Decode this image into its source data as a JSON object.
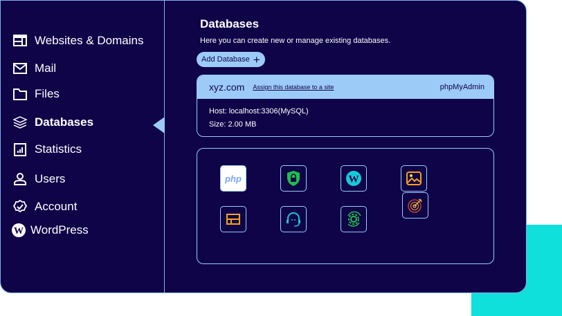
{
  "sidebar": {
    "items": [
      {
        "label": "Websites & Domains",
        "icon": "browser-window-icon"
      },
      {
        "label": "Mail",
        "icon": "envelope-icon"
      },
      {
        "label": "Files",
        "icon": "folder-icon"
      },
      {
        "label": "Databases",
        "icon": "layers-icon",
        "active": true
      },
      {
        "label": "Statistics",
        "icon": "bar-chart-icon"
      },
      {
        "label": "Users",
        "icon": "user-icon"
      },
      {
        "label": "Account",
        "icon": "badge-check-icon"
      },
      {
        "label": "WordPress",
        "icon": "wordpress-icon"
      }
    ]
  },
  "main": {
    "title": "Databases",
    "subtitle": "Here you can create new or manage existing databases.",
    "add_button": "Add Database",
    "database": {
      "name": "xyz.com",
      "assign_link": "Assign this database to a site",
      "admin_link": "phpMyAdmin",
      "host": "Host: localhost:3306(MySQL)",
      "size": "Size: 2.00 MB"
    },
    "apps": {
      "php_label": "php"
    }
  },
  "colors": {
    "background": "#0f0448",
    "accent": "#9ccbf7",
    "cyan": "#0fe0dc"
  }
}
